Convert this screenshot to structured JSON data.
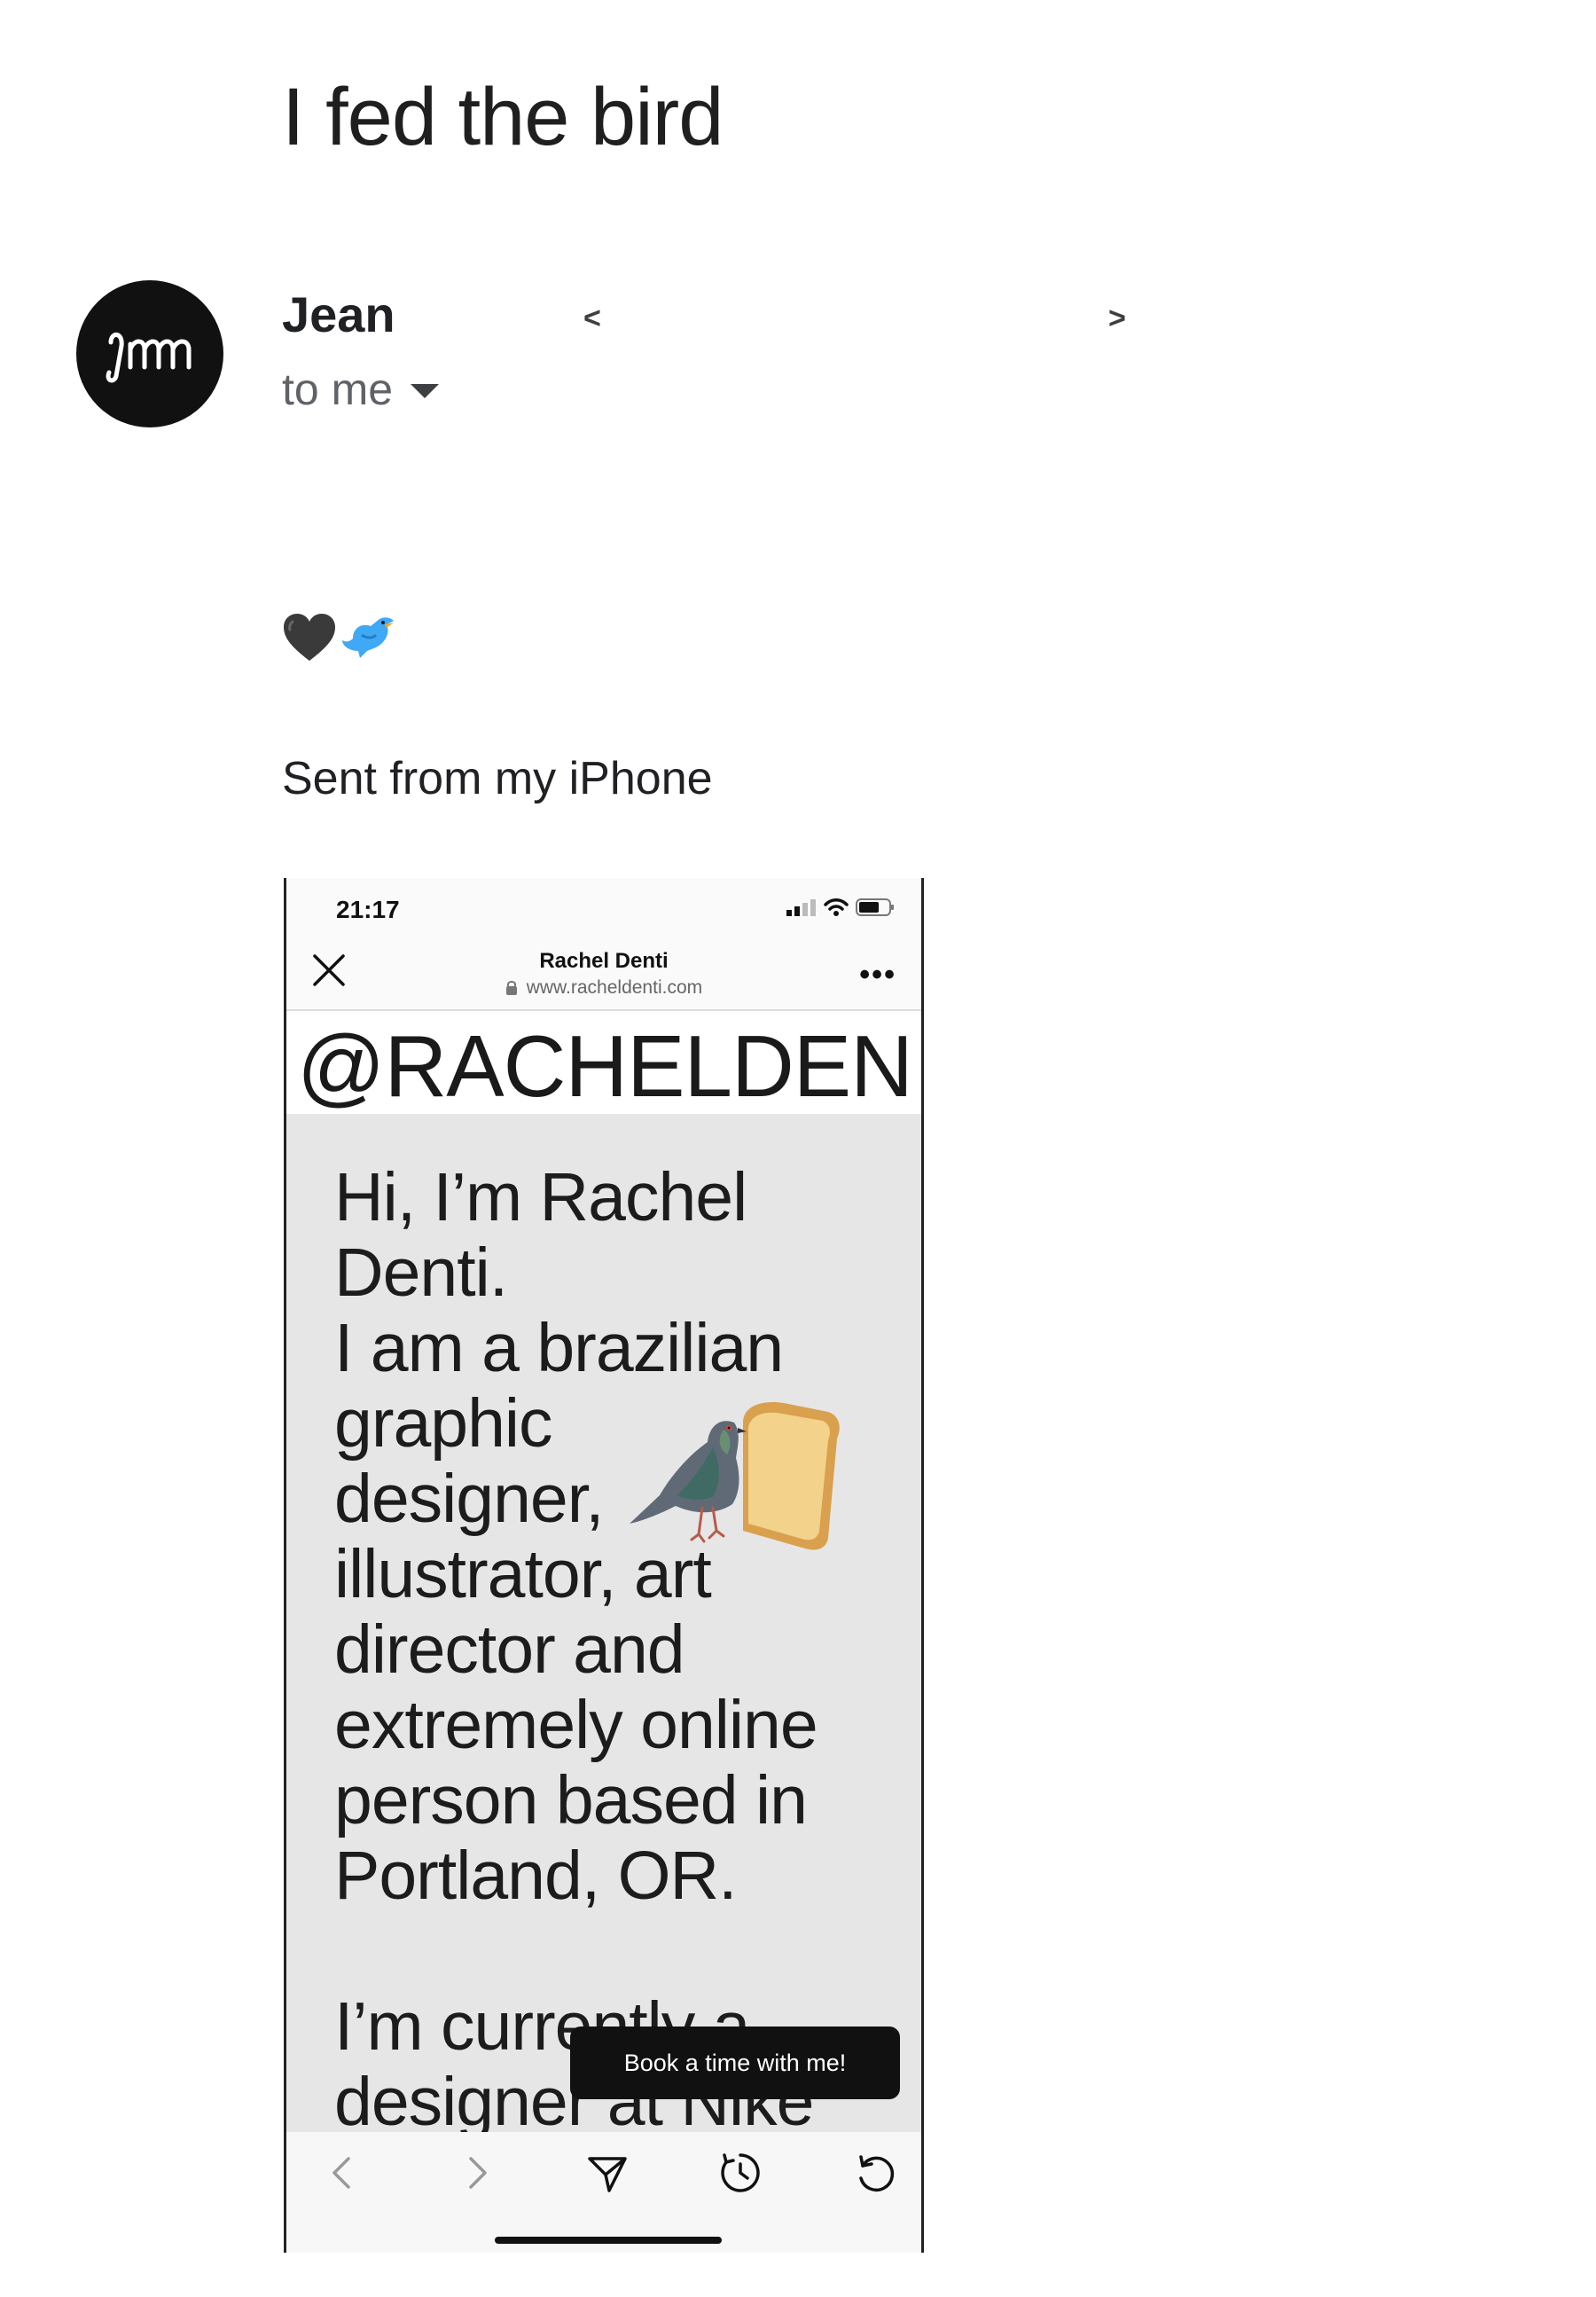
{
  "email": {
    "subject": "I fed the bird",
    "sender_name": "Jean",
    "recipient": "to me",
    "body_emojis": [
      "🖤",
      "🐦"
    ],
    "signature": "Sent from my iPhone",
    "nav_prev": "<",
    "nav_next": ">"
  },
  "attachment_screenshot": {
    "status_time": "21:17",
    "site_title": "Rachel Denti",
    "site_url": "www.racheldenti.com",
    "more_menu": "•••",
    "handle": "@RACHELDEN",
    "bio_lines": [
      "Hi, I’m Rachel",
      "Denti.",
      "I am a brazilian",
      "graphic",
      "designer,",
      "illustrator, art",
      "director and",
      "extremely online",
      "person based in",
      "Portland, OR."
    ],
    "bio_more_lines": [
      "I’m currently a",
      "designer at Nike"
    ],
    "cta_button": "Book a time with me!"
  },
  "icons": {
    "avatar": "jm-monogram-icon",
    "dropdown": "caret-down-icon",
    "close": "close-icon",
    "back": "chevron-left-icon",
    "forward": "chevron-right-icon",
    "share": "send-icon",
    "history": "history-icon",
    "reload": "reload-icon"
  }
}
